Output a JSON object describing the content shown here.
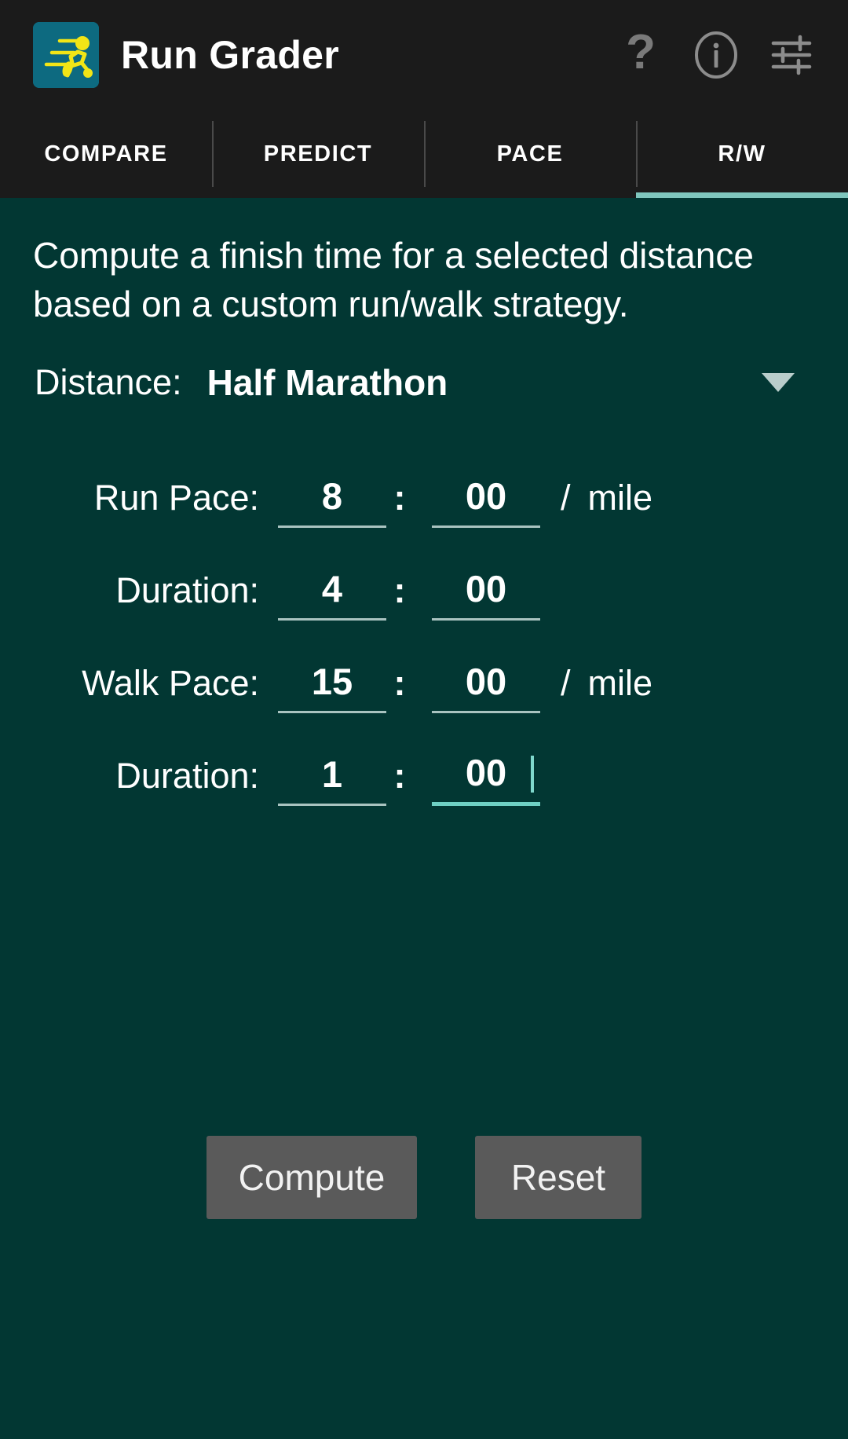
{
  "app": {
    "title": "Run Grader",
    "icon_name": "running-figure-icon",
    "accent_color": "#7fc6bd",
    "background_color": "#023733",
    "appbar_color": "#1b1b1b",
    "icon_bg_color": "#0d6a80",
    "icon_fg_color": "#f2e516"
  },
  "appbar_actions": [
    {
      "name": "help-icon",
      "glyph": "?"
    },
    {
      "name": "info-icon",
      "glyph": "i"
    },
    {
      "name": "settings-sliders-icon",
      "glyph": "sliders"
    }
  ],
  "tabs": [
    {
      "label": "COMPARE",
      "active": false
    },
    {
      "label": "PREDICT",
      "active": false
    },
    {
      "label": "PACE",
      "active": false
    },
    {
      "label": "R/W",
      "active": true
    }
  ],
  "main": {
    "description": "Compute a finish time for a selected distance based on a custom run/walk strategy.",
    "distance": {
      "label": "Distance:",
      "value": "Half Marathon",
      "caret_icon": "chevron-down-icon"
    },
    "rows": [
      {
        "label": "Run Pace:",
        "minutes": "8",
        "separator": ":",
        "seconds": "00",
        "unit_slash": "/",
        "unit": "mile",
        "has_unit": true,
        "focused": false
      },
      {
        "label": "Duration:",
        "minutes": "4",
        "separator": ":",
        "seconds": "00",
        "unit_slash": "",
        "unit": "",
        "has_unit": false,
        "focused": false
      },
      {
        "label": "Walk Pace:",
        "minutes": "15",
        "separator": ":",
        "seconds": "00",
        "unit_slash": "/",
        "unit": "mile",
        "has_unit": true,
        "focused": false
      },
      {
        "label": "Duration:",
        "minutes": "1",
        "separator": ":",
        "seconds": "00",
        "unit_slash": "",
        "unit": "",
        "has_unit": false,
        "focused": true
      }
    ],
    "buttons": {
      "compute": "Compute",
      "reset": "Reset"
    }
  }
}
